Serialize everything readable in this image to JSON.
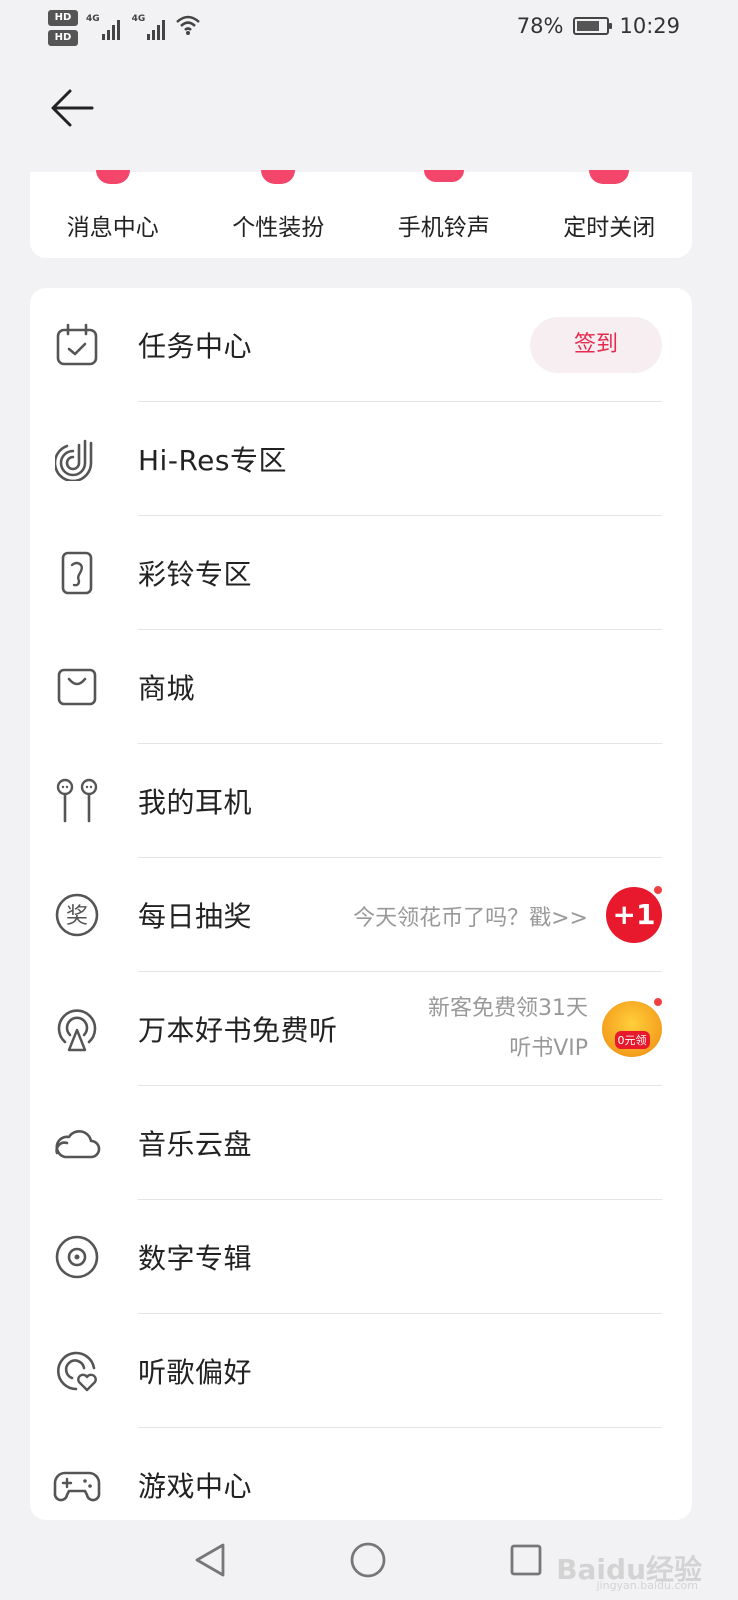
{
  "status_bar": {
    "hd_badges": [
      "HD",
      "HD"
    ],
    "network_1": "4G",
    "network_2": "4G",
    "battery_percent": "78%",
    "battery_level": 0.78,
    "time": "10:29"
  },
  "header": {
    "back_icon": "arrow-left-icon"
  },
  "quick_actions": [
    {
      "label": "消息中心",
      "icon": "message-icon"
    },
    {
      "label": "个性装扮",
      "icon": "shirt-icon"
    },
    {
      "label": "手机铃声",
      "icon": "bell-icon"
    },
    {
      "label": "定时关闭",
      "icon": "timer-icon"
    }
  ],
  "menu": {
    "items": [
      {
        "label": "任务中心",
        "icon": "calendar-check-icon",
        "action": "签到"
      },
      {
        "label": "Hi-Res专区",
        "icon": "hires-icon"
      },
      {
        "label": "彩铃专区",
        "icon": "ringtone-icon"
      },
      {
        "label": "商城",
        "icon": "bag-icon"
      },
      {
        "label": "我的耳机",
        "icon": "earphones-icon"
      },
      {
        "label": "每日抽奖",
        "icon": "lottery-icon",
        "hint": "今天领花币了吗？戳>>",
        "badge": "+1"
      },
      {
        "label": "万本好书免费听",
        "icon": "podcast-icon",
        "hint_line1": "新客免费领31天",
        "hint_line2": "听书VIP",
        "badge_text": "0元领"
      },
      {
        "label": "音乐云盘",
        "icon": "cloud-icon"
      },
      {
        "label": "数字专辑",
        "icon": "disc-icon"
      },
      {
        "label": "听歌偏好",
        "icon": "preference-icon"
      },
      {
        "label": "游戏中心",
        "icon": "gamepad-icon"
      }
    ]
  },
  "nav_bar": {
    "back": "triangle-back-icon",
    "home": "circle-home-icon",
    "recent": "square-recent-icon"
  },
  "watermark": {
    "main": "Baidu经验",
    "sub": "jingyan.baidu.com"
  }
}
